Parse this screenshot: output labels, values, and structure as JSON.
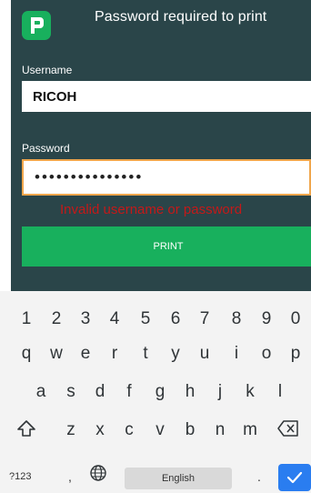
{
  "dialog": {
    "title": "Password required to print",
    "username_label": "Username",
    "username_value": "RICOH",
    "password_label": "Password",
    "password_value": "•••••••••••••••",
    "error_message": "Invalid username or password",
    "print_label": "PRINT"
  },
  "keyboard": {
    "row_numbers": [
      "1",
      "2",
      "3",
      "4",
      "5",
      "6",
      "7",
      "8",
      "9",
      "0"
    ],
    "row_top": [
      "q",
      "w",
      "e",
      "r",
      "t",
      "y",
      "u",
      "i",
      "o",
      "p"
    ],
    "row_middle": [
      "a",
      "s",
      "d",
      "f",
      "g",
      "h",
      "j",
      "k",
      "l"
    ],
    "row_bottom": [
      "z",
      "x",
      "c",
      "v",
      "b",
      "n",
      "m"
    ],
    "symbols_label": "?123",
    "comma": ",",
    "space_label": "English",
    "period": "."
  },
  "colors": {
    "dialog_bg": "#2a4549",
    "accent_green": "#18b05d",
    "error_red": "#c41919",
    "focus_orange": "#f0a64c",
    "enter_blue": "#2a7df0"
  }
}
